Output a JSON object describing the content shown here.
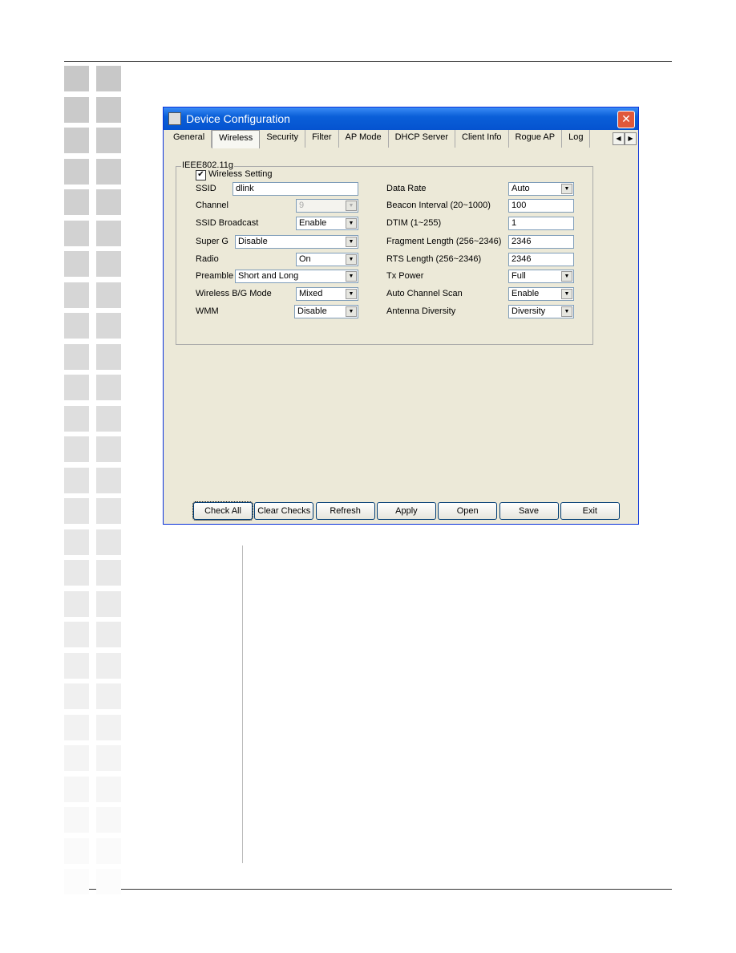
{
  "window": {
    "title": "Device Configuration",
    "close": "✕"
  },
  "tabs": [
    "General",
    "Wireless",
    "Security",
    "Filter",
    "AP Mode",
    "DHCP Server",
    "Client Info",
    "Rogue AP",
    "Log"
  ],
  "active_tab": "Wireless",
  "group": {
    "legend": "IEEE802.11g",
    "wireless_setting": {
      "label": "Wireless Setting",
      "checked": true
    }
  },
  "left": [
    {
      "label": "SSID",
      "value": "dlink",
      "type": "text"
    },
    {
      "label": "Channel",
      "value": "9",
      "type": "select",
      "disabled": true
    },
    {
      "label": "SSID Broadcast",
      "value": "Enable",
      "type": "select"
    },
    {
      "label": "Super G",
      "value": "Disable",
      "type": "select"
    },
    {
      "label": "Radio",
      "value": "On",
      "type": "select"
    },
    {
      "label": "Preamble",
      "value": "Short and Long",
      "type": "select"
    },
    {
      "label": "Wireless B/G Mode",
      "value": "Mixed",
      "type": "select"
    },
    {
      "label": "WMM",
      "value": "Disable",
      "type": "select"
    }
  ],
  "right": [
    {
      "label": "Data Rate",
      "value": "Auto",
      "type": "select"
    },
    {
      "label": "Beacon Interval (20~1000)",
      "value": "100",
      "type": "text"
    },
    {
      "label": "DTIM (1~255)",
      "value": "1",
      "type": "text"
    },
    {
      "label": "Fragment Length (256~2346)",
      "value": "2346",
      "type": "text"
    },
    {
      "label": "RTS Length (256~2346)",
      "value": "2346",
      "type": "text"
    },
    {
      "label": "Tx Power",
      "value": "Full",
      "type": "select"
    },
    {
      "label": "Auto Channel Scan",
      "value": "Enable",
      "type": "select"
    },
    {
      "label": "Antenna Diversity",
      "value": "Diversity",
      "type": "select"
    }
  ],
  "buttons": [
    "Check All",
    "Clear Checks",
    "Refresh",
    "Apply",
    "Open",
    "Save",
    "Exit"
  ],
  "colors": {
    "titlebar": "#0a5fd8",
    "dialog_bg": "#ece9d8"
  }
}
